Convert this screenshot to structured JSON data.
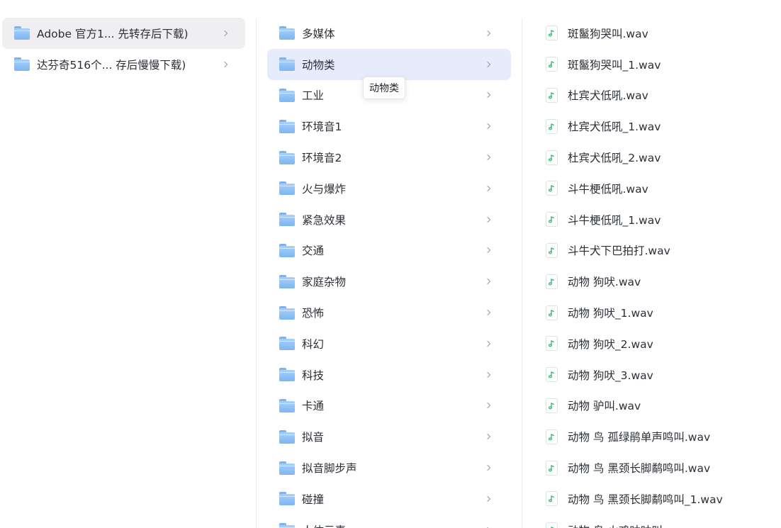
{
  "column1": {
    "items": [
      {
        "label": "Adobe 官方1...  先转存后下载)",
        "icon": "folder-icon",
        "selected": true
      },
      {
        "label": "达芬奇516个...  存后慢慢下载)",
        "icon": "folder-icon",
        "selected": false
      }
    ]
  },
  "column2": {
    "items": [
      {
        "label": "多媒体",
        "icon": "folder-icon"
      },
      {
        "label": "动物类",
        "icon": "folder-icon",
        "active": true
      },
      {
        "label": "工业",
        "icon": "folder-icon"
      },
      {
        "label": "环境音1",
        "icon": "folder-icon"
      },
      {
        "label": "环境音2",
        "icon": "folder-icon"
      },
      {
        "label": "火与爆炸",
        "icon": "folder-icon"
      },
      {
        "label": "紧急效果",
        "icon": "folder-icon"
      },
      {
        "label": "交通",
        "icon": "folder-icon"
      },
      {
        "label": "家庭杂物",
        "icon": "folder-icon"
      },
      {
        "label": "恐怖",
        "icon": "folder-icon"
      },
      {
        "label": "科幻",
        "icon": "folder-icon"
      },
      {
        "label": "科技",
        "icon": "folder-icon"
      },
      {
        "label": "卡通",
        "icon": "folder-icon"
      },
      {
        "label": "拟音",
        "icon": "folder-icon"
      },
      {
        "label": "拟音脚步声",
        "icon": "folder-icon"
      },
      {
        "label": "碰撞",
        "icon": "folder-icon"
      },
      {
        "label": "人体元素",
        "icon": "folder-icon"
      }
    ]
  },
  "column3": {
    "items": [
      {
        "label": "斑鬣狗哭叫.wav",
        "icon": "audio-file-icon"
      },
      {
        "label": "斑鬣狗哭叫_1.wav",
        "icon": "audio-file-icon"
      },
      {
        "label": "杜宾犬低吼.wav",
        "icon": "audio-file-icon"
      },
      {
        "label": "杜宾犬低吼_1.wav",
        "icon": "audio-file-icon"
      },
      {
        "label": "杜宾犬低吼_2.wav",
        "icon": "audio-file-icon"
      },
      {
        "label": "斗牛梗低吼.wav",
        "icon": "audio-file-icon"
      },
      {
        "label": "斗牛梗低吼_1.wav",
        "icon": "audio-file-icon"
      },
      {
        "label": "斗牛犬下巴拍打.wav",
        "icon": "audio-file-icon"
      },
      {
        "label": "动物 狗吠.wav",
        "icon": "audio-file-icon"
      },
      {
        "label": "动物 狗吠_1.wav",
        "icon": "audio-file-icon"
      },
      {
        "label": "动物 狗吠_2.wav",
        "icon": "audio-file-icon"
      },
      {
        "label": "动物 狗吠_3.wav",
        "icon": "audio-file-icon"
      },
      {
        "label": "动物 驴叫.wav",
        "icon": "audio-file-icon"
      },
      {
        "label": "动物 鸟 孤绿鹃单声鸣叫.wav",
        "icon": "audio-file-icon"
      },
      {
        "label": "动物 鸟 黑颈长脚鹬鸣叫.wav",
        "icon": "audio-file-icon"
      },
      {
        "label": "动物 鸟 黑颈长脚鹬鸣叫_1.wav",
        "icon": "audio-file-icon"
      },
      {
        "label": "动物 鸟 火鸡咕咕叫.wav",
        "icon": "audio-file-icon"
      }
    ]
  },
  "tooltip": {
    "text": "动物类"
  },
  "colors": {
    "selected_bg": "#efeff1",
    "active_bg": "#e6ecfc",
    "folder_blue": "#7db5f1",
    "audio_green": "#2fb36b"
  }
}
